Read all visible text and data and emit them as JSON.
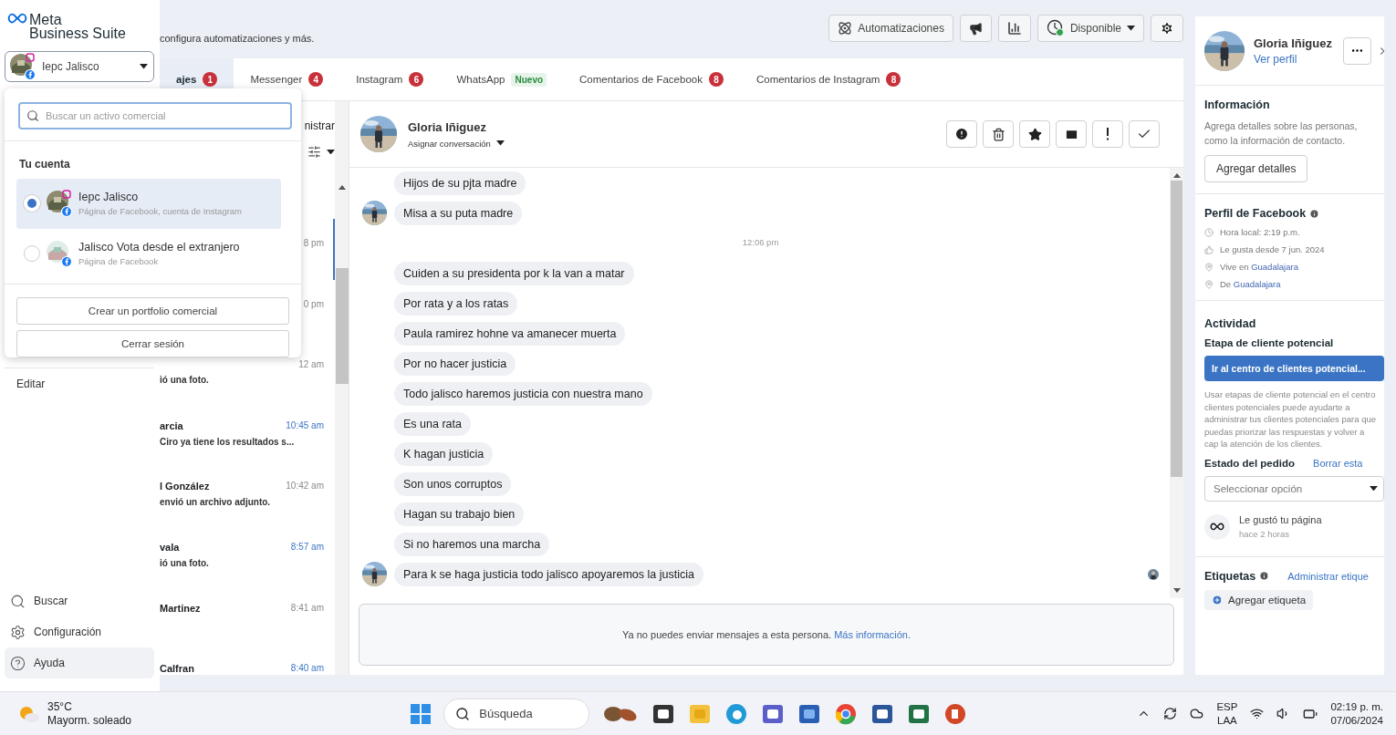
{
  "brand": {
    "line1": "Meta",
    "line2": "Business Suite"
  },
  "account_selector": {
    "value": "Iepc Jalisco"
  },
  "header": {
    "description": "configura automatizaciones y más."
  },
  "toolbar": {
    "automations": "Automatizaciones",
    "status": "Disponible",
    "status_online": true
  },
  "account_menu": {
    "search_placeholder": "Buscar un activo comercial",
    "heading": "Tu cuenta",
    "accounts": [
      {
        "name": "Iepc Jalisco",
        "subtitle": "Página de Facebook, cuenta de Instagram",
        "selected": true
      },
      {
        "name": "Jalisco Vota desde el extranjero",
        "subtitle": "Página de Facebook",
        "selected": false
      }
    ],
    "buttons": [
      "Crear un portfolio comercial",
      "Cerrar sesión"
    ]
  },
  "sidebar": {
    "edit": "Editar",
    "items": [
      {
        "kind": "search",
        "label": "Buscar",
        "selected": false
      },
      {
        "kind": "settings",
        "label": "Configuración",
        "selected": false
      },
      {
        "kind": "help",
        "label": "Ayuda",
        "selected": true
      }
    ]
  },
  "tabs": [
    {
      "label": "ajes",
      "selected": true,
      "badge": "1"
    },
    {
      "label": "Messenger",
      "selected": false,
      "badge": "4"
    },
    {
      "label": "Instagram",
      "selected": false,
      "badge": "6"
    },
    {
      "label": "WhatsApp",
      "selected": false,
      "tag": "Nuevo"
    },
    {
      "label": "Comentarios de Facebook",
      "selected": false,
      "badge": "8"
    },
    {
      "label": "Comentarios de Instagram",
      "selected": false,
      "badge": "8"
    }
  ],
  "inbox": {
    "manage": "nistrar",
    "rows": [
      {
        "time": "8 pm",
        "unread": false,
        "selected": true
      },
      {
        "time": "0 pm",
        "unread": false,
        "selected": false
      },
      {
        "time": "12 am",
        "preview": "ió una foto.",
        "unread": false,
        "selected": false
      },
      {
        "name": "arcia",
        "preview": "Ciro ya tiene los resultados s...",
        "time": "10:45 am",
        "unread": true,
        "selected": false
      },
      {
        "name": "l González",
        "preview": "envió un archivo adjunto.",
        "time": "10:42 am",
        "unread": false,
        "selected": false
      },
      {
        "name": "vala",
        "preview": "ió una foto.",
        "time": "8:57 am",
        "unread": true,
        "selected": false
      },
      {
        "name": "Martinez",
        "time": "8:41 am",
        "unread": false,
        "selected": false
      },
      {
        "name": "Calfran",
        "time": "8:40 am",
        "unread": true,
        "selected": false
      }
    ]
  },
  "chat": {
    "contact": "Gloria Iñiguez",
    "assign": "Asignar conversación",
    "messages": [
      {
        "kind": "message",
        "text": "Hijos de su pjta madre",
        "avatar": false,
        "seen": false
      },
      {
        "kind": "message",
        "text": "Misa a su puta madre",
        "avatar": true,
        "seen": false
      },
      {
        "kind": "timestamp",
        "text": "12:06 pm"
      },
      {
        "kind": "message",
        "text": "Cuiden a su presidenta por k la van a matar",
        "avatar": false,
        "seen": false
      },
      {
        "kind": "message",
        "text": "Por rata y a los ratas",
        "avatar": false,
        "seen": false
      },
      {
        "kind": "message",
        "text": "Paula ramirez hohne va amanecer muerta",
        "avatar": false,
        "seen": false
      },
      {
        "kind": "message",
        "text": "Por no hacer justicia",
        "avatar": false,
        "seen": false
      },
      {
        "kind": "message",
        "text": "Todo jalisco haremos justicia con nuestra mano",
        "avatar": false,
        "seen": false
      },
      {
        "kind": "message",
        "text": "Es una rata",
        "avatar": false,
        "seen": false
      },
      {
        "kind": "message",
        "text": "K hagan justicia",
        "avatar": false,
        "seen": false
      },
      {
        "kind": "message",
        "text": "Son unos corruptos",
        "avatar": false,
        "seen": false
      },
      {
        "kind": "message",
        "text": "Hagan su trabajo bien",
        "avatar": false,
        "seen": false
      },
      {
        "kind": "message",
        "text": "Si no haremos una marcha",
        "avatar": false,
        "seen": false
      },
      {
        "kind": "message",
        "text": "Para k se haga justicia todo jalisco apoyaremos la justicia",
        "avatar": true,
        "seen": true
      }
    ],
    "notice": "Ya no puedes enviar mensajes a esta persona.",
    "notice_link": "Más información."
  },
  "profile": {
    "name": "Gloria Iñiguez",
    "view": "Ver perfil",
    "info_title": "Información",
    "info_text": "Agrega detalles sobre las personas, como la información de contacto.",
    "add_details": "Agregar detalles",
    "fb_title": "Perfil de Facebook",
    "fb_rows": [
      {
        "kind": "clock",
        "text": "Hora local: 2:19 p.m."
      },
      {
        "kind": "like",
        "text": "Le gusta desde 7 jun. 2024"
      },
      {
        "kind": "place",
        "text": "Vive en",
        "link": "Guadalajara"
      },
      {
        "kind": "place",
        "text": "De",
        "link": "Guadalajara"
      }
    ],
    "activity_title": "Actividad",
    "lead_title": "Etapa de cliente potencial",
    "lead_button": "Ir al centro de clientes potencial...",
    "lead_text": "Usar etapas de cliente potencial en el centro clientes potenciales puede ayudarte a administrar tus clientes potenciales para que puedas priorizar las respuestas y volver a cap la atención de los clientes.",
    "order_title": "Estado del pedido",
    "order_clear": "Borrar esta",
    "order_select": "Seleccionar opción",
    "event_title": "Le gustó tu página",
    "event_time": "hace 2 horas",
    "tags_title": "Etiquetas",
    "tags_manage": "Administrar etique",
    "add_tag": "Agregar etiqueta"
  },
  "taskbar": {
    "temp": "35°C",
    "weather": "Mayorm. soleado",
    "search": "Búsqueda",
    "lang1": "ESP",
    "lang2": "LAA",
    "time": "02:19 p. m.",
    "date": "07/06/2024"
  }
}
